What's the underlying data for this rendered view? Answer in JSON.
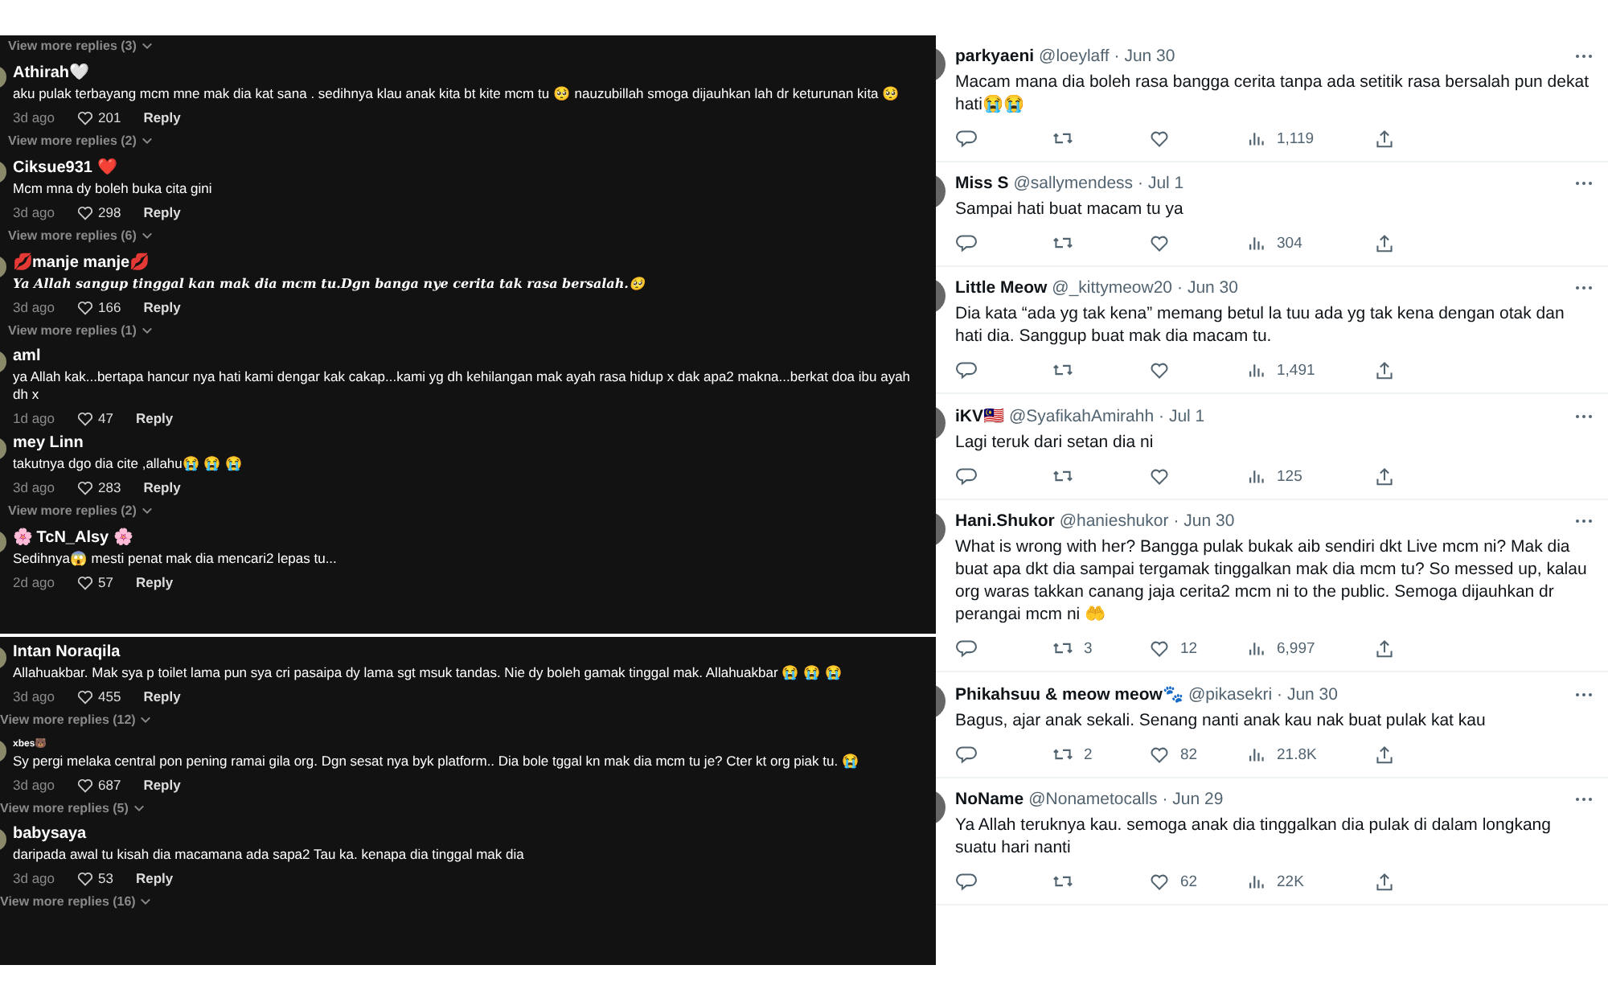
{
  "comment_panels": [
    {
      "top_link": "View more replies (3)",
      "comments": [
        {
          "kind": "plain",
          "name": "Athirah🤍",
          "text": "aku pulak terbayang mcm mne mak dia kat sana . sedihnya klau anak kita bt kite mcm tu 🥺 nauzubillah smoga dijauhkan lah dr keturunan kita 🥺",
          "age": "3d ago",
          "likes": "201",
          "reply": "Reply",
          "more": "View more replies (2)"
        },
        {
          "kind": "plain",
          "name": "Ciksue931 ❤️",
          "text": "Mcm mna dy boleh buka cita gini",
          "age": "3d ago",
          "likes": "298",
          "reply": "Reply",
          "more": "View more replies (6)"
        },
        {
          "kind": "fancy",
          "name": "💋manje manje💋",
          "text": "Ya Allah sangup tinggal kan mak dia mcm tu.Dgn banga nye cerita tak rasa bersalah.🥺",
          "age": "3d ago",
          "likes": "166",
          "reply": "Reply",
          "more": "View more replies (1)"
        },
        {
          "kind": "plain",
          "name": "aml",
          "text": "ya Allah kak...bertapa hancur nya hati kami dengar kak cakap...kami yg dh kehilangan mak ayah rasa hidup x dak apa2 makna...berkat doa ibu ayah dh x",
          "age": "1d ago",
          "likes": "47",
          "reply": "Reply"
        },
        {
          "kind": "plain",
          "name": "mey Linn",
          "text": "takutnya dgo dia cite ,allahu😭 😭 😭",
          "age": "3d ago",
          "likes": "283",
          "reply": "Reply",
          "more": "View more replies (2)"
        },
        {
          "kind": "plain",
          "name": "🌸 TcN_Alsy 🌸",
          "text": "Sedihnya😱 mesti penat mak dia mencari2 lepas tu...",
          "age": "2d ago",
          "likes": "57",
          "reply": "Reply"
        }
      ]
    },
    {
      "comments": [
        {
          "kind": "plain",
          "name": "Intan Noraqila",
          "text": "Allahuakbar. Mak sya p toilet lama pun sya cri pasaipa dy lama sgt msuk tandas. Nie dy boleh gamak tinggal mak. Allahuakbar 😭 😭 😭",
          "age": "3d ago",
          "likes": "455",
          "reply": "Reply",
          "more": "View more replies (12)"
        },
        {
          "kind": "small",
          "name": "xbes🐻",
          "text": "Sy pergi melaka central pon pening ramai gila org. Dgn sesat nya byk platform.. Dia bole tggal kn mak dia mcm tu je? Cter kt org piak tu. 😭",
          "age": "3d ago",
          "likes": "687",
          "reply": "Reply",
          "more": "View more replies (5)"
        },
        {
          "kind": "plain",
          "name": "babysaya",
          "text": "daripada awal tu kisah dia macamana ada sapa2 Tau ka. kenapa dia tinggal mak dia",
          "age": "3d ago",
          "likes": "53",
          "reply": "Reply",
          "more": "View more replies (16)"
        }
      ]
    }
  ],
  "tweets": [
    {
      "name": "parkyaeni",
      "handle": "@loeylaff",
      "date": "· Jun 30",
      "text": "Macam mana dia boleh rasa bangga cerita tanpa ada setitik rasa bersalah pun dekat hati😭😭",
      "views": "1,119"
    },
    {
      "name": "Miss S",
      "handle": "@sallymendess",
      "date": "· Jul 1",
      "text": "Sampai hati buat macam tu ya",
      "views": "304"
    },
    {
      "name": "Little Meow",
      "handle": "@_kittymeow20",
      "date": "· Jun 30",
      "text": "Dia kata “ada yg tak kena” memang betul la tuu ada yg tak kena dengan otak dan hati dia. Sanggup buat mak dia macam tu.",
      "views": "1,491"
    },
    {
      "name": "iKV🇲🇾",
      "handle": "@SyafikahAmirahh",
      "date": "· Jul 1",
      "text": "Lagi teruk dari setan dia ni",
      "views": "125"
    },
    {
      "name": "Hani.Shukor",
      "handle": "@hanieshukor",
      "date": "· Jun 30",
      "text": "What is wrong with her? Bangga pulak bukak aib sendiri dkt Live mcm ni? Mak dia buat apa dkt dia sampai tergamak tinggalkan mak dia mcm tu? So messed up, kalau org waras takkan canang jaja cerita2 mcm ni to the public. Semoga dijauhkan dr perangai mcm ni 🤲",
      "retweets": "3",
      "likes": "12",
      "views": "6,997"
    },
    {
      "name": "Phikahsuu & meow meow🐾",
      "handle": "@pikasekri",
      "date": "· Jun 30",
      "text": "Bagus, ajar anak sekali. Senang nanti anak kau nak buat pulak kat kau",
      "retweets": "2",
      "likes": "82",
      "views": "21.8K"
    },
    {
      "name": "NoName",
      "handle": "@Nonametocalls",
      "date": "· Jun 29",
      "text": "Ya Allah teruknya kau. semoga anak dia tinggalkan dia pulak di dalam longkang suatu hari nanti",
      "likes": "62",
      "views": "22K"
    }
  ]
}
